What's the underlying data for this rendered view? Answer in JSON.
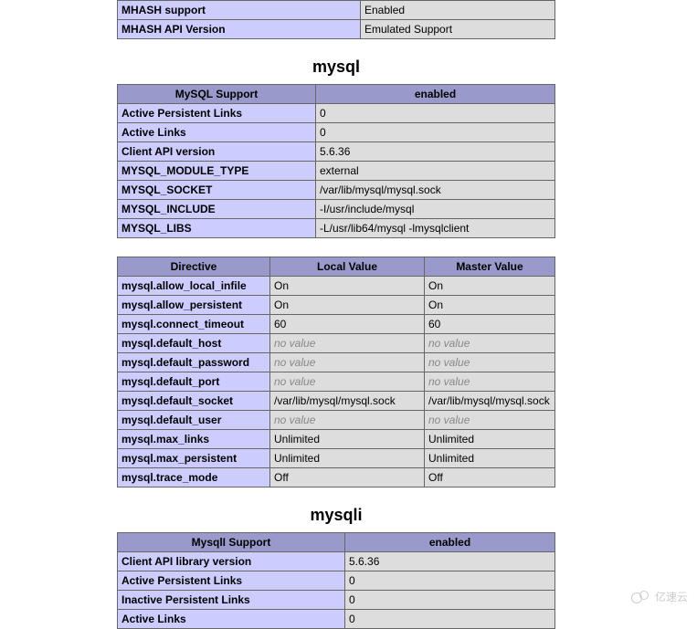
{
  "mhash_table": {
    "rows": [
      {
        "key": "MHASH support",
        "value": "Enabled"
      },
      {
        "key": "MHASH API Version",
        "value": "Emulated Support"
      }
    ]
  },
  "mysql_section": {
    "title": "mysql",
    "support_table": {
      "header": [
        "MySQL Support",
        "enabled"
      ],
      "rows": [
        {
          "key": "Active Persistent Links",
          "value": "0"
        },
        {
          "key": "Active Links",
          "value": "0"
        },
        {
          "key": "Client API version",
          "value": "5.6.36"
        },
        {
          "key": "MYSQL_MODULE_TYPE",
          "value": "external"
        },
        {
          "key": "MYSQL_SOCKET",
          "value": "/var/lib/mysql/mysql.sock"
        },
        {
          "key": "MYSQL_INCLUDE",
          "value": "-I/usr/include/mysql"
        },
        {
          "key": "MYSQL_LIBS",
          "value": "-L/usr/lib64/mysql -lmysqlclient"
        }
      ]
    },
    "directive_table": {
      "header": [
        "Directive",
        "Local Value",
        "Master Value"
      ],
      "rows": [
        {
          "key": "mysql.allow_local_infile",
          "local": "On",
          "master": "On"
        },
        {
          "key": "mysql.allow_persistent",
          "local": "On",
          "master": "On"
        },
        {
          "key": "mysql.connect_timeout",
          "local": "60",
          "master": "60"
        },
        {
          "key": "mysql.default_host",
          "local": "no value",
          "master": "no value",
          "novalue": true
        },
        {
          "key": "mysql.default_password",
          "local": "no value",
          "master": "no value",
          "novalue": true
        },
        {
          "key": "mysql.default_port",
          "local": "no value",
          "master": "no value",
          "novalue": true
        },
        {
          "key": "mysql.default_socket",
          "local": "/var/lib/mysql/mysql.sock",
          "master": "/var/lib/mysql/mysql.sock"
        },
        {
          "key": "mysql.default_user",
          "local": "no value",
          "master": "no value",
          "novalue": true
        },
        {
          "key": "mysql.max_links",
          "local": "Unlimited",
          "master": "Unlimited"
        },
        {
          "key": "mysql.max_persistent",
          "local": "Unlimited",
          "master": "Unlimited"
        },
        {
          "key": "mysql.trace_mode",
          "local": "Off",
          "master": "Off"
        }
      ]
    }
  },
  "mysqli_section": {
    "title": "mysqli",
    "support_table": {
      "header": [
        "MysqlI Support",
        "enabled"
      ],
      "rows": [
        {
          "key": "Client API library version",
          "value": "5.6.36"
        },
        {
          "key": "Active Persistent Links",
          "value": "0"
        },
        {
          "key": "Inactive Persistent Links",
          "value": "0"
        },
        {
          "key": "Active Links",
          "value": "0"
        }
      ]
    }
  },
  "watermark": "亿速云"
}
